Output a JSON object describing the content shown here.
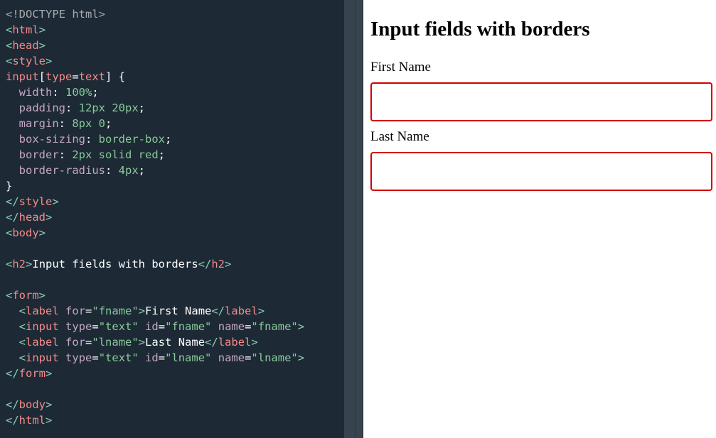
{
  "editor": {
    "lines": [
      [
        {
          "c": "doctype",
          "t": "<!DOCTYPE html>"
        }
      ],
      [
        {
          "c": "br",
          "t": "<"
        },
        {
          "c": "tag",
          "t": "html"
        },
        {
          "c": "br",
          "t": ">"
        }
      ],
      [
        {
          "c": "br",
          "t": "<"
        },
        {
          "c": "tag",
          "t": "head"
        },
        {
          "c": "br",
          "t": ">"
        }
      ],
      [
        {
          "c": "br",
          "t": "<"
        },
        {
          "c": "tag",
          "t": "style"
        },
        {
          "c": "br",
          "t": ">"
        }
      ],
      [
        {
          "c": "sel",
          "t": "input"
        },
        {
          "c": "punc",
          "t": "["
        },
        {
          "c": "sel",
          "t": "type"
        },
        {
          "c": "punc",
          "t": "="
        },
        {
          "c": "sel",
          "t": "text"
        },
        {
          "c": "punc",
          "t": "] {"
        }
      ],
      [
        {
          "c": "punc",
          "t": "  "
        },
        {
          "c": "prop",
          "t": "width"
        },
        {
          "c": "punc",
          "t": ": "
        },
        {
          "c": "val",
          "t": "100%"
        },
        {
          "c": "punc",
          "t": ";"
        }
      ],
      [
        {
          "c": "punc",
          "t": "  "
        },
        {
          "c": "prop",
          "t": "padding"
        },
        {
          "c": "punc",
          "t": ": "
        },
        {
          "c": "val",
          "t": "12px 20px"
        },
        {
          "c": "punc",
          "t": ";"
        }
      ],
      [
        {
          "c": "punc",
          "t": "  "
        },
        {
          "c": "prop",
          "t": "margin"
        },
        {
          "c": "punc",
          "t": ": "
        },
        {
          "c": "val",
          "t": "8px 0"
        },
        {
          "c": "punc",
          "t": ";"
        }
      ],
      [
        {
          "c": "punc",
          "t": "  "
        },
        {
          "c": "prop",
          "t": "box-sizing"
        },
        {
          "c": "punc",
          "t": ": "
        },
        {
          "c": "val",
          "t": "border-box"
        },
        {
          "c": "punc",
          "t": ";"
        }
      ],
      [
        {
          "c": "punc",
          "t": "  "
        },
        {
          "c": "prop",
          "t": "border"
        },
        {
          "c": "punc",
          "t": ": "
        },
        {
          "c": "val",
          "t": "2px solid red"
        },
        {
          "c": "punc",
          "t": ";"
        }
      ],
      [
        {
          "c": "punc",
          "t": "  "
        },
        {
          "c": "prop",
          "t": "border-radius"
        },
        {
          "c": "punc",
          "t": ": "
        },
        {
          "c": "val",
          "t": "4px"
        },
        {
          "c": "punc",
          "t": ";"
        }
      ],
      [
        {
          "c": "punc",
          "t": "}"
        }
      ],
      [
        {
          "c": "br",
          "t": "</"
        },
        {
          "c": "tag",
          "t": "style"
        },
        {
          "c": "br",
          "t": ">"
        }
      ],
      [
        {
          "c": "br",
          "t": "</"
        },
        {
          "c": "tag",
          "t": "head"
        },
        {
          "c": "br",
          "t": ">"
        }
      ],
      [
        {
          "c": "br",
          "t": "<"
        },
        {
          "c": "tag",
          "t": "body"
        },
        {
          "c": "br",
          "t": ">"
        }
      ],
      [],
      [
        {
          "c": "br",
          "t": "<"
        },
        {
          "c": "tag",
          "t": "h2"
        },
        {
          "c": "br",
          "t": ">"
        },
        {
          "c": "txt",
          "t": "Input fields with borders"
        },
        {
          "c": "br",
          "t": "</"
        },
        {
          "c": "tag",
          "t": "h2"
        },
        {
          "c": "br",
          "t": ">"
        }
      ],
      [],
      [
        {
          "c": "br",
          "t": "<"
        },
        {
          "c": "tag",
          "t": "form"
        },
        {
          "c": "br",
          "t": ">"
        }
      ],
      [
        {
          "c": "punc",
          "t": "  "
        },
        {
          "c": "br",
          "t": "<"
        },
        {
          "c": "tag",
          "t": "label"
        },
        {
          "c": "punc",
          "t": " "
        },
        {
          "c": "attr",
          "t": "for"
        },
        {
          "c": "punc",
          "t": "="
        },
        {
          "c": "aval",
          "t": "\"fname\""
        },
        {
          "c": "br",
          "t": ">"
        },
        {
          "c": "txt",
          "t": "First Name"
        },
        {
          "c": "br",
          "t": "</"
        },
        {
          "c": "tag",
          "t": "label"
        },
        {
          "c": "br",
          "t": ">"
        }
      ],
      [
        {
          "c": "punc",
          "t": "  "
        },
        {
          "c": "br",
          "t": "<"
        },
        {
          "c": "tag",
          "t": "input"
        },
        {
          "c": "punc",
          "t": " "
        },
        {
          "c": "attr",
          "t": "type"
        },
        {
          "c": "punc",
          "t": "="
        },
        {
          "c": "aval",
          "t": "\"text\""
        },
        {
          "c": "punc",
          "t": " "
        },
        {
          "c": "attr",
          "t": "id"
        },
        {
          "c": "punc",
          "t": "="
        },
        {
          "c": "aval",
          "t": "\"fname\""
        },
        {
          "c": "punc",
          "t": " "
        },
        {
          "c": "attr",
          "t": "name"
        },
        {
          "c": "punc",
          "t": "="
        },
        {
          "c": "aval",
          "t": "\"fname\""
        },
        {
          "c": "br",
          "t": ">"
        }
      ],
      [
        {
          "c": "punc",
          "t": "  "
        },
        {
          "c": "br",
          "t": "<"
        },
        {
          "c": "tag",
          "t": "label"
        },
        {
          "c": "punc",
          "t": " "
        },
        {
          "c": "attr",
          "t": "for"
        },
        {
          "c": "punc",
          "t": "="
        },
        {
          "c": "aval",
          "t": "\"lname\""
        },
        {
          "c": "br",
          "t": ">"
        },
        {
          "c": "txt",
          "t": "Last Name"
        },
        {
          "c": "br",
          "t": "</"
        },
        {
          "c": "tag",
          "t": "label"
        },
        {
          "c": "br",
          "t": ">"
        }
      ],
      [
        {
          "c": "punc",
          "t": "  "
        },
        {
          "c": "br",
          "t": "<"
        },
        {
          "c": "tag",
          "t": "input"
        },
        {
          "c": "punc",
          "t": " "
        },
        {
          "c": "attr",
          "t": "type"
        },
        {
          "c": "punc",
          "t": "="
        },
        {
          "c": "aval",
          "t": "\"text\""
        },
        {
          "c": "punc",
          "t": " "
        },
        {
          "c": "attr",
          "t": "id"
        },
        {
          "c": "punc",
          "t": "="
        },
        {
          "c": "aval",
          "t": "\"lname\""
        },
        {
          "c": "punc",
          "t": " "
        },
        {
          "c": "attr",
          "t": "name"
        },
        {
          "c": "punc",
          "t": "="
        },
        {
          "c": "aval",
          "t": "\"lname\""
        },
        {
          "c": "br",
          "t": ">"
        }
      ],
      [
        {
          "c": "br",
          "t": "</"
        },
        {
          "c": "tag",
          "t": "form"
        },
        {
          "c": "br",
          "t": ">"
        }
      ],
      [],
      [
        {
          "c": "br",
          "t": "</"
        },
        {
          "c": "tag",
          "t": "body"
        },
        {
          "c": "br",
          "t": ">"
        }
      ],
      [
        {
          "c": "br",
          "t": "</"
        },
        {
          "c": "tag",
          "t": "html"
        },
        {
          "c": "br",
          "t": ">"
        }
      ]
    ]
  },
  "preview": {
    "heading": "Input fields with borders",
    "fields": [
      {
        "label": "First Name",
        "value": "",
        "placeholder": ""
      },
      {
        "label": "Last Name",
        "value": "",
        "placeholder": ""
      }
    ],
    "input_border_color": "#d40000"
  },
  "colors": {
    "editor_bg": "#1d2a35",
    "divider_bg": "#38444d"
  }
}
